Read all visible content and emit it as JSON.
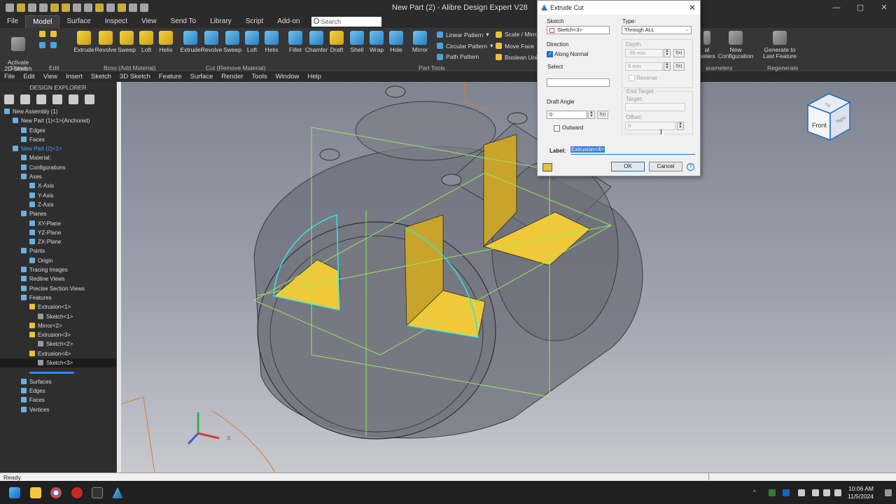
{
  "window": {
    "title": "New Part (2) - Alibre Design Expert V28",
    "controls": [
      "—",
      "▢",
      "✕"
    ]
  },
  "ribbon_tabs": [
    "File",
    "Model",
    "Surface",
    "Inspect",
    "View",
    "Send To",
    "Library",
    "Script",
    "Add-on"
  ],
  "active_tab": "Model",
  "search": {
    "placeholder": "Search"
  },
  "ribbon": {
    "sketch": {
      "activate_label": "Activate\n2D Sketch",
      "group": "Sketch"
    },
    "edit_group": "Edit",
    "boss": {
      "items": [
        "Extrude",
        "Revolve",
        "Sweep",
        "Loft",
        "Helix"
      ],
      "group": "Boss (Add Material)"
    },
    "cut": {
      "items": [
        "Extrude",
        "Revolve",
        "Sweep",
        "Loft",
        "Helix"
      ],
      "group": "Cut (Remove Material)"
    },
    "tools": {
      "items": [
        "Fillet",
        "Chamfer",
        "Draft",
        "Shell",
        "Wrap",
        "Hole",
        "Mirror"
      ],
      "group": "Part Tools"
    },
    "patterns": [
      "Linear Pattern",
      "Circular Pattern",
      "Path Pattern"
    ],
    "moves": [
      "Scale / Mirror F",
      "Move Face",
      "Boolean Unite"
    ],
    "right": {
      "parameters_label": "al\nneters",
      "new_config": "New Configuration",
      "generate": "Generate to\nLast Feature",
      "parameters_group": "arameters",
      "regenerate_group": "Regenerate"
    }
  },
  "menubar": [
    "File",
    "Edit",
    "View",
    "Insert",
    "Sketch",
    "3D Sketch",
    "Feature",
    "Surface",
    "Render",
    "Tools",
    "Window",
    "Help"
  ],
  "explorer": {
    "title": "DESIGN EXPLORER",
    "tree": [
      {
        "label": "New Assembly (1)",
        "indent": 0
      },
      {
        "label": "New Part (1)<1>(Anchored)",
        "indent": 1
      },
      {
        "label": "Edges",
        "indent": 2
      },
      {
        "label": "Faces",
        "indent": 2
      },
      {
        "label": "New Part (2)<1>",
        "indent": 1,
        "blue": true
      },
      {
        "label": "Material:",
        "indent": 2
      },
      {
        "label": "Configurations",
        "indent": 2
      },
      {
        "label": "Axes",
        "indent": 2
      },
      {
        "label": "X-Axis",
        "indent": 3
      },
      {
        "label": "Y-Axis",
        "indent": 3
      },
      {
        "label": "Z-Axis",
        "indent": 3
      },
      {
        "label": "Planes",
        "indent": 2
      },
      {
        "label": "XY-Plane",
        "indent": 3
      },
      {
        "label": "YZ-Plane",
        "indent": 3
      },
      {
        "label": "ZX-Plane",
        "indent": 3
      },
      {
        "label": "Points",
        "indent": 2
      },
      {
        "label": "Origin",
        "indent": 3
      },
      {
        "label": "Tracing Images",
        "indent": 2
      },
      {
        "label": "Redline Views",
        "indent": 2
      },
      {
        "label": "Precise Section Views",
        "indent": 2
      },
      {
        "label": "Features",
        "indent": 2
      },
      {
        "label": "Extrusion<1>",
        "indent": 3,
        "feature": true
      },
      {
        "label": "Sketch<1>",
        "indent": 4
      },
      {
        "label": "Mirror<2>",
        "indent": 3,
        "feature": true
      },
      {
        "label": "Extrusion<3>",
        "indent": 3,
        "feature": true
      },
      {
        "label": "Sketch<2>",
        "indent": 4
      },
      {
        "label": "Extrusion<4>",
        "indent": 3,
        "feature": true
      },
      {
        "label": "Sketch<3>",
        "indent": 4,
        "selected": true
      },
      {
        "label": "",
        "indent": 3,
        "rollback": true
      },
      {
        "label": "Surfaces",
        "indent": 2
      },
      {
        "label": "Edges",
        "indent": 2
      },
      {
        "label": "Faces",
        "indent": 2
      },
      {
        "label": "Vertices",
        "indent": 2
      }
    ]
  },
  "dialog": {
    "title": "Extrude Cut",
    "sketch_label": "Sketch",
    "sketch_value": "Sketch<3>",
    "type_label": "Type:",
    "type_value": "Through ALL",
    "direction_label": "Direction",
    "along_normal": "Along Normal",
    "along_normal_checked": true,
    "select_label": "Select",
    "depth_label": "Depth",
    "depth_value": "-35 mm",
    "depth2_value": "5 mm",
    "reverse_label": "Reverse",
    "end_target_label": "End Target",
    "target_label": "Target:",
    "offset_label": "Offset:",
    "offset_value": "0",
    "draft_angle_label": "Draft Angle",
    "draft_angle_value": "0",
    "outward_label": "Outward",
    "fx": "f(x)",
    "label_label": "Label:",
    "label_value": "Extrusion<4>",
    "ok": "OK",
    "cancel": "Cancel",
    "help": "?"
  },
  "viewcube": {
    "front": "Front",
    "right": "Right",
    "top": "Top"
  },
  "triad": {
    "x": "X"
  },
  "status": {
    "text": "Ready"
  },
  "taskbar": {
    "time": "10:06 AM",
    "date": "11/5/2024"
  },
  "colors": {
    "accent": "#1a73c7",
    "feature_yellow": "#f0c93a",
    "sketch_cyan": "#2ee6e6",
    "plane_green": "#9be85a"
  }
}
